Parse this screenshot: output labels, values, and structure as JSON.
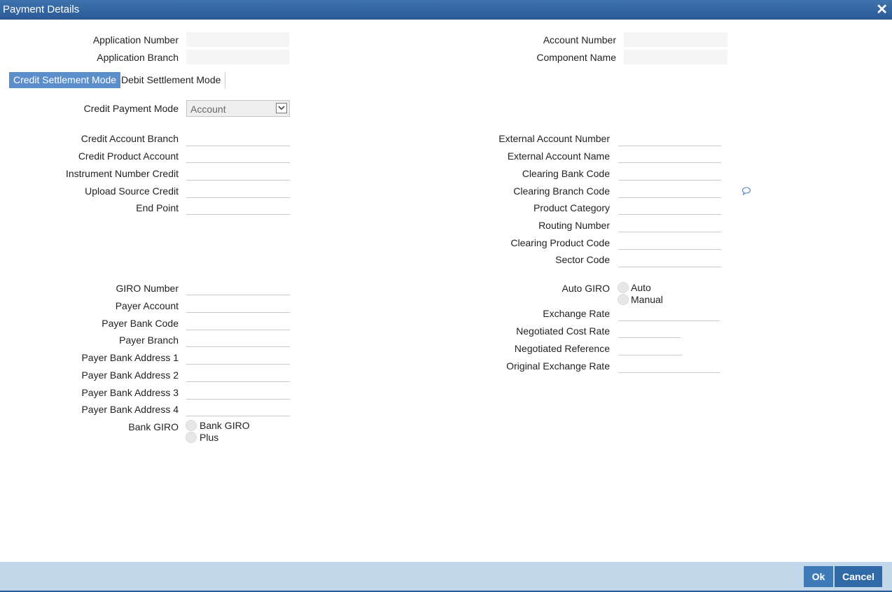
{
  "window": {
    "title": "Payment Details",
    "close_glyph": "✕"
  },
  "header": {
    "application_number_label": "Application Number",
    "application_branch_label": "Application Branch",
    "account_number_label": "Account Number",
    "component_name_label": "Component Name",
    "application_number_value": "",
    "application_branch_value": "",
    "account_number_value": "",
    "component_name_value": ""
  },
  "tabs": [
    {
      "label": "Credit Settlement Mode",
      "active": true
    },
    {
      "label": "Debit Settlement Mode",
      "active": false
    }
  ],
  "credit": {
    "payment_mode_label": "Credit Payment Mode",
    "payment_mode_value": "Account",
    "left_fields": [
      {
        "label": "Credit Account Branch",
        "value": ""
      },
      {
        "label": "Credit Product Account",
        "value": ""
      },
      {
        "label": "Instrument Number Credit",
        "value": ""
      },
      {
        "label": "Upload Source Credit",
        "value": ""
      },
      {
        "label": "End Point",
        "value": ""
      }
    ],
    "right_fields": [
      {
        "label": "External Account Number",
        "value": ""
      },
      {
        "label": "External Account Name",
        "value": ""
      },
      {
        "label": "Clearing Bank Code",
        "value": ""
      },
      {
        "label": "Clearing Branch Code",
        "value": ""
      },
      {
        "label": "Product Category",
        "value": ""
      },
      {
        "label": "Routing Number",
        "value": ""
      },
      {
        "label": "Clearing Product Code",
        "value": ""
      },
      {
        "label": "Sector Code",
        "value": ""
      }
    ],
    "giro_fields": [
      {
        "label": "GIRO Number",
        "value": ""
      },
      {
        "label": "Payer Account",
        "value": ""
      },
      {
        "label": "Payer Bank Code",
        "value": ""
      },
      {
        "label": "Payer Branch",
        "value": ""
      },
      {
        "label": "Payer Bank Address 1",
        "value": ""
      },
      {
        "label": "Payer Bank Address 2",
        "value": ""
      },
      {
        "label": "Payer Bank Address 3",
        "value": ""
      },
      {
        "label": "Payer Bank Address 4",
        "value": ""
      }
    ],
    "bank_giro": {
      "label": "Bank GIRO",
      "options": [
        "Bank GIRO",
        "Plus"
      ]
    },
    "auto_giro": {
      "label": "Auto GIRO",
      "options": [
        "Auto",
        "Manual"
      ]
    },
    "rate_fields": [
      {
        "label": "Exchange Rate",
        "value": ""
      },
      {
        "label": "Negotiated Cost Rate",
        "value": ""
      },
      {
        "label": "Negotiated Reference",
        "value": ""
      },
      {
        "label": "Original Exchange Rate",
        "value": ""
      }
    ]
  },
  "footer": {
    "ok_label": "Ok",
    "cancel_label": "Cancel"
  },
  "colors": {
    "titlebar": "#2a5a96",
    "active_tab": "#5b8fcb",
    "footer": "#c2d7ea",
    "button": "#2f6aa6"
  },
  "icons": {
    "close": "close-icon",
    "select_arrow": "chevron-down-icon",
    "comment": "speech-bubble-icon"
  }
}
